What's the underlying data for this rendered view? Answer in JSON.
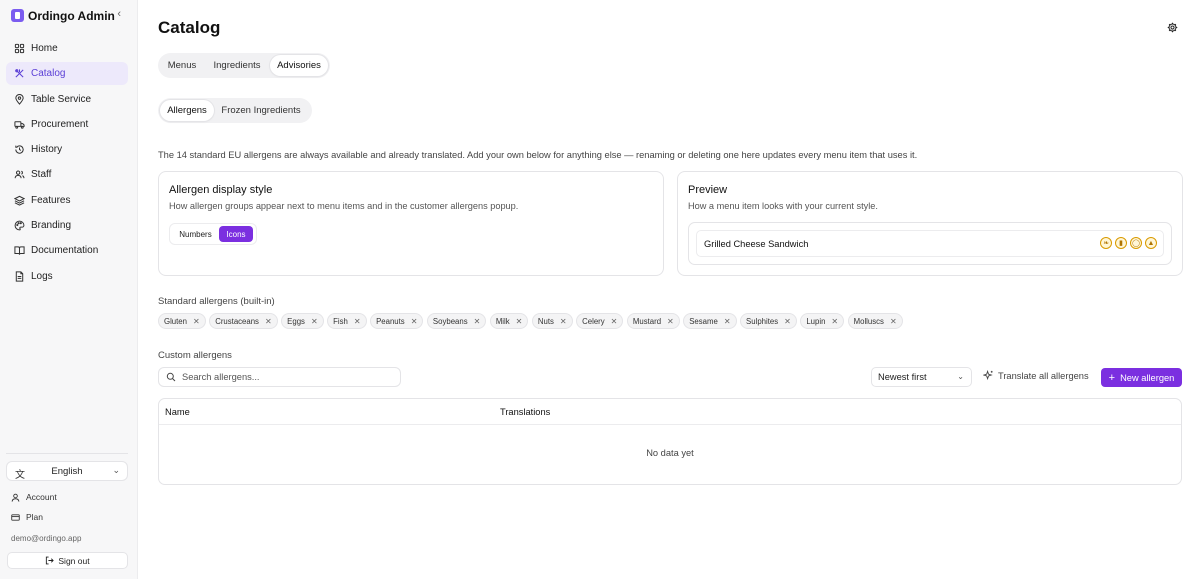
{
  "app": {
    "name": "Ordingo Admin"
  },
  "sidebar": {
    "items": [
      {
        "label": "Home",
        "icon": "home-icon",
        "active": false
      },
      {
        "label": "Catalog",
        "icon": "catalog-icon",
        "active": true
      },
      {
        "label": "Table Service",
        "icon": "map-pin-icon",
        "active": false
      },
      {
        "label": "Procurement",
        "icon": "truck-icon",
        "active": false
      },
      {
        "label": "History",
        "icon": "history-icon",
        "active": false
      },
      {
        "label": "Staff",
        "icon": "users-icon",
        "active": false
      },
      {
        "label": "Features",
        "icon": "layers-icon",
        "active": false
      },
      {
        "label": "Branding",
        "icon": "palette-icon",
        "active": false
      },
      {
        "label": "Documentation",
        "icon": "book-icon",
        "active": false
      },
      {
        "label": "Logs",
        "icon": "file-icon",
        "active": false
      }
    ],
    "language": "English",
    "account_label": "Account",
    "plan_label": "Plan",
    "email": "demo@ordingo.app",
    "signout_label": "Sign out"
  },
  "main": {
    "title": "Catalog",
    "tabs": [
      {
        "label": "Menus",
        "active": false
      },
      {
        "label": "Ingredients",
        "active": false
      },
      {
        "label": "Advisories",
        "active": true
      }
    ],
    "subtabs": [
      {
        "label": "Allergens",
        "active": true
      },
      {
        "label": "Frozen Ingredients",
        "active": false
      }
    ],
    "intro": "The 14 standard EU allergens are always available and already translated. Add your own below for anything else — renaming or deleting one here updates every menu item that uses it.",
    "display_style": {
      "title": "Allergen display style",
      "subtitle": "How allergen groups appear next to menu items and in the customer allergens popup.",
      "options": [
        "Numbers",
        "Icons"
      ],
      "selected": "Icons"
    },
    "preview": {
      "title": "Preview",
      "subtitle": "How a menu item looks with your current style.",
      "item_name": "Grilled Cheese Sandwich",
      "icons": [
        "wheat-icon",
        "milk-icon",
        "egg-icon",
        "cheese-icon"
      ]
    },
    "standard_allergens": {
      "label": "Standard allergens (built-in)",
      "items": [
        "Gluten",
        "Crustaceans",
        "Eggs",
        "Fish",
        "Peanuts",
        "Soybeans",
        "Milk",
        "Nuts",
        "Celery",
        "Mustard",
        "Sesame",
        "Sulphites",
        "Lupin",
        "Molluscs"
      ]
    },
    "custom_allergens": {
      "label": "Custom allergens",
      "search_placeholder": "Search allergens...",
      "sort_value": "Newest first",
      "translate_label": "Translate all allergens",
      "new_label": "New allergen",
      "columns": [
        "Name",
        "Translations"
      ],
      "empty_text": "No data yet"
    }
  },
  "colors": {
    "accent": "#7b2fe0",
    "active_nav_bg": "#ede9fb",
    "active_nav_text": "#5b3fd6"
  }
}
